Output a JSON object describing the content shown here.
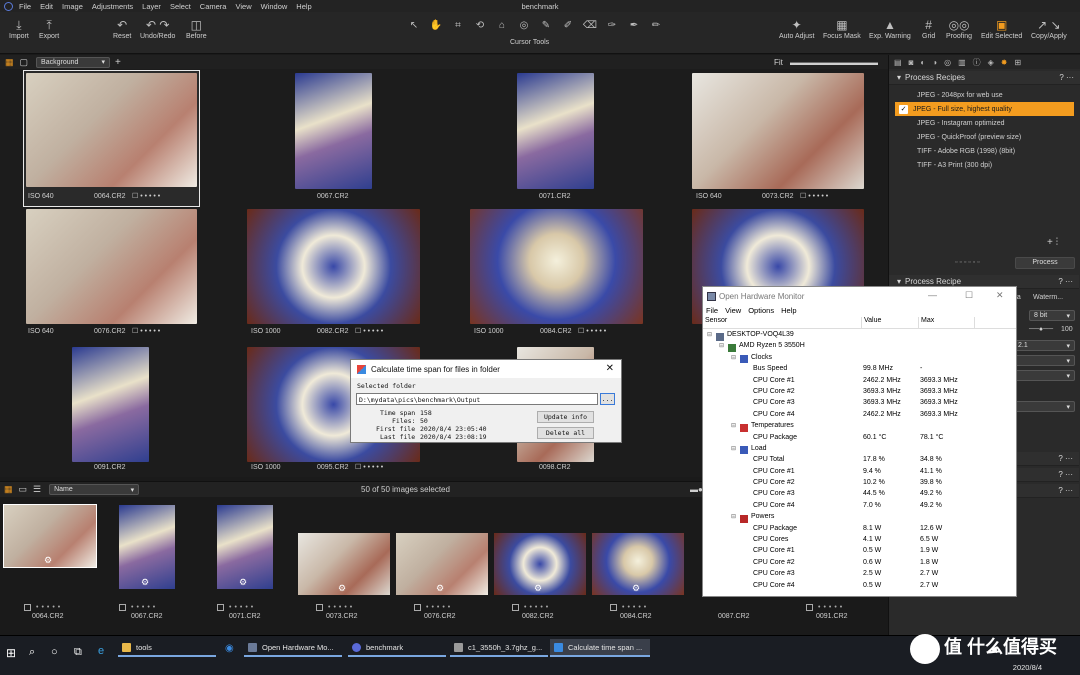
{
  "app": {
    "title": "benchmark",
    "menu": [
      "File",
      "Edit",
      "Image",
      "Adjustments",
      "Layer",
      "Select",
      "Camera",
      "View",
      "Window",
      "Help"
    ]
  },
  "toolbar": {
    "left": [
      {
        "label": "Import",
        "icon": "import-icon"
      },
      {
        "label": "Export",
        "icon": "export-icon"
      }
    ],
    "mid": [
      {
        "label": "Reset",
        "icon": "reset-icon"
      },
      {
        "label": "Undo/Redo",
        "icon": "undo-icon"
      },
      {
        "label": "Before",
        "icon": "before-icon"
      }
    ],
    "cursor_tools_label": "Cursor Tools",
    "right": [
      {
        "label": "Auto Adjust",
        "icon": "auto-adjust-icon"
      },
      {
        "label": "Focus Mask",
        "icon": "focus-mask-icon"
      },
      {
        "label": "Exp. Warning",
        "icon": "warning-icon"
      },
      {
        "label": "Grid",
        "icon": "grid-icon"
      },
      {
        "label": "Proofing",
        "icon": "proofing-icon"
      },
      {
        "label": "Edit Selected",
        "icon": "edit-selected-icon"
      },
      {
        "label": "Copy/Apply",
        "icon": "copy-apply-icon"
      }
    ]
  },
  "viewbar": {
    "layer_select": "Background",
    "fit_label": "Fit"
  },
  "grid": [
    {
      "name": "0064.CR2",
      "iso": "ISO 640",
      "selected": true
    },
    {
      "name": "0067.CR2",
      "iso": ""
    },
    {
      "name": "0071.CR2",
      "iso": ""
    },
    {
      "name": "0073.CR2",
      "iso": "ISO 640"
    },
    {
      "name": "0076.CR2",
      "iso": "ISO 640"
    },
    {
      "name": "0082.CR2",
      "iso": "ISO 1000"
    },
    {
      "name": "0084.CR2",
      "iso": "ISO 1000"
    },
    {
      "name": "0091.CR2",
      "iso": ""
    },
    {
      "name": "0095.CR2",
      "iso": "ISO 1000"
    },
    {
      "name": "0098.CR2",
      "iso": ""
    }
  ],
  "filmbar": {
    "sort": "Name",
    "status": "50 of 50 images selected"
  },
  "film": [
    "0064.CR2",
    "0067.CR2",
    "0071.CR2",
    "0073.CR2",
    "0076.CR2",
    "0082.CR2",
    "0084.CR2",
    "0087.CR2",
    "0091.CR2"
  ],
  "process": {
    "recipes_title": "Process Recipes",
    "recipes": [
      {
        "label": "JPEG - 2048px for web use",
        "checked": false
      },
      {
        "label": "JPEG - Full size, highest quality",
        "checked": true
      },
      {
        "label": "JPEG - Instagram optimized",
        "checked": false
      },
      {
        "label": "JPEG - QuickProof (preview size)",
        "checked": false
      },
      {
        "label": "TIFF - Adobe RGB (1998) (8bit)",
        "checked": false
      },
      {
        "label": "TIFF - A3 Print (300 dpi)",
        "checked": false
      }
    ],
    "process_button": "Process",
    "recipe_title": "Process Recipe",
    "frag_ata": "ata",
    "frag_waterm": "Waterm...",
    "frag_bit": "8 bit",
    "frag_100": "100",
    "frag_21": "2.1"
  },
  "dialog": {
    "title": "Calculate time span for files in folder",
    "selected_folder_label": "Selected folder",
    "folder": "D:\\mydata\\pics\\benchmark\\Output",
    "browse": "...",
    "lines": [
      {
        "k": "Time span",
        "v": "158"
      },
      {
        "k": "Files:",
        "v": "50"
      },
      {
        "k": "First file",
        "v": "2020/8/4 23:05:40"
      },
      {
        "k": "Last file",
        "v": "2020/8/4 23:08:19"
      }
    ],
    "update_btn": "Update info",
    "delete_btn": "Delete all"
  },
  "ohm": {
    "title": "Open Hardware Monitor",
    "menu": [
      "File",
      "View",
      "Options",
      "Help"
    ],
    "headers": [
      "Sensor",
      "Value",
      "Max"
    ],
    "rows": [
      {
        "indent": 0,
        "name": "DESKTOP-VOQ4L39",
        "value": "",
        "max": "",
        "icon": "computer-icon",
        "color": "#5a6a88"
      },
      {
        "indent": 1,
        "name": "AMD Ryzen 5 3550H",
        "value": "",
        "max": "",
        "icon": "cpu-icon",
        "color": "#3a7a3a"
      },
      {
        "indent": 2,
        "name": "Clocks",
        "value": "",
        "max": "",
        "icon": "clock-icon",
        "color": "#3a5ab8"
      },
      {
        "indent": 3,
        "name": "Bus Speed",
        "value": "99.8 MHz",
        "max": "-"
      },
      {
        "indent": 3,
        "name": "CPU Core #1",
        "value": "2462.2 MHz",
        "max": "3693.3 MHz"
      },
      {
        "indent": 3,
        "name": "CPU Core #2",
        "value": "3693.3 MHz",
        "max": "3693.3 MHz"
      },
      {
        "indent": 3,
        "name": "CPU Core #3",
        "value": "3693.3 MHz",
        "max": "3693.3 MHz"
      },
      {
        "indent": 3,
        "name": "CPU Core #4",
        "value": "2462.2 MHz",
        "max": "3693.3 MHz"
      },
      {
        "indent": 2,
        "name": "Temperatures",
        "value": "",
        "max": "",
        "icon": "thermometer-icon",
        "color": "#c83030"
      },
      {
        "indent": 3,
        "name": "CPU Package",
        "value": "60.1 °C",
        "max": "78.1 °C"
      },
      {
        "indent": 2,
        "name": "Load",
        "value": "",
        "max": "",
        "icon": "load-icon",
        "color": "#3a5ab8"
      },
      {
        "indent": 3,
        "name": "CPU Total",
        "value": "17.8 %",
        "max": "34.8 %"
      },
      {
        "indent": 3,
        "name": "CPU Core #1",
        "value": "9.4 %",
        "max": "41.1 %"
      },
      {
        "indent": 3,
        "name": "CPU Core #2",
        "value": "10.2 %",
        "max": "39.8 %"
      },
      {
        "indent": 3,
        "name": "CPU Core #3",
        "value": "44.5 %",
        "max": "49.2 %"
      },
      {
        "indent": 3,
        "name": "CPU Core #4",
        "value": "7.0 %",
        "max": "49.2 %"
      },
      {
        "indent": 2,
        "name": "Powers",
        "value": "",
        "max": "",
        "icon": "power-icon",
        "color": "#b82828"
      },
      {
        "indent": 3,
        "name": "CPU Package",
        "value": "8.1 W",
        "max": "12.6 W"
      },
      {
        "indent": 3,
        "name": "CPU Cores",
        "value": "4.1 W",
        "max": "6.5 W"
      },
      {
        "indent": 3,
        "name": "CPU Core #1",
        "value": "0.5 W",
        "max": "1.9 W"
      },
      {
        "indent": 3,
        "name": "CPU Core #2",
        "value": "0.6 W",
        "max": "1.8 W"
      },
      {
        "indent": 3,
        "name": "CPU Core #3",
        "value": "2.5 W",
        "max": "2.7 W"
      },
      {
        "indent": 3,
        "name": "CPU Core #4",
        "value": "0.5 W",
        "max": "2.7 W"
      }
    ]
  },
  "taskbar": {
    "tasks": [
      {
        "label": "tools",
        "state": "run",
        "icon_color": "#e8b84a"
      },
      {
        "label": "Open Hardware Mo...",
        "state": "run",
        "icon_color": "#6a7a98"
      },
      {
        "label": "benchmark",
        "state": "run",
        "icon_color": "#5a6ad8"
      },
      {
        "label": "c1_3550h_3.7ghz_g...",
        "state": "run",
        "icon_color": "#9a9a9a"
      },
      {
        "label": "Calculate time span ...",
        "state": "act",
        "icon_color": "#3a8ae0"
      }
    ],
    "date": "2020/8/4",
    "watermark": "值 什么值得买"
  },
  "colors": {
    "accent": "#f39c1f"
  }
}
